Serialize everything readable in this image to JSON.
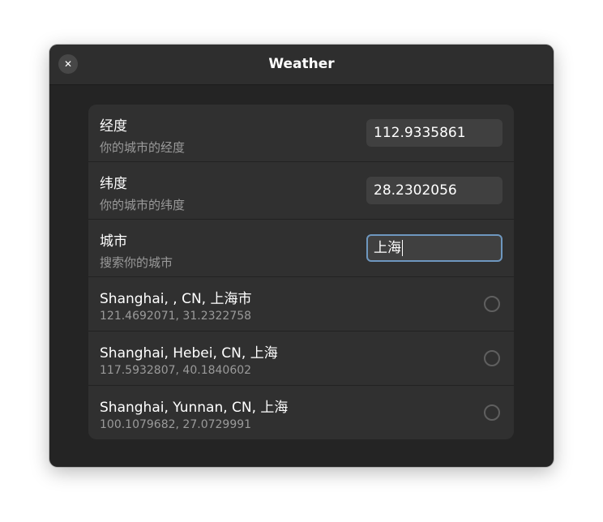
{
  "window": {
    "title": "Weather",
    "close_glyph": "✕"
  },
  "settings": [
    {
      "title": "经度",
      "subtitle": "你的城市的经度",
      "value": "112.9335861"
    },
    {
      "title": "纬度",
      "subtitle": "你的城市的纬度",
      "value": "28.2302056"
    },
    {
      "title": "城市",
      "subtitle": "搜索你的城市",
      "value": "上海"
    }
  ],
  "results": [
    {
      "name": "Shanghai, , CN, 上海市",
      "coords": "121.4692071, 31.2322758",
      "selected": false
    },
    {
      "name": "Shanghai, Hebei, CN, 上海",
      "coords": "117.5932807, 40.1840602",
      "selected": false
    },
    {
      "name": "Shanghai, Yunnan, CN, 上海",
      "coords": "100.1079682, 27.0729991",
      "selected": false
    }
  ],
  "colors": {
    "window_bg": "#242424",
    "headerbar_bg": "#2e2e2e",
    "list_bg": "#303030",
    "entry_bg": "#404040",
    "focus_ring": "#6e97bf",
    "text_primary": "#ffffff",
    "text_secondary": "#9a9a9a"
  },
  "icons": {
    "close": "close-icon",
    "radio": "radio-icon"
  }
}
